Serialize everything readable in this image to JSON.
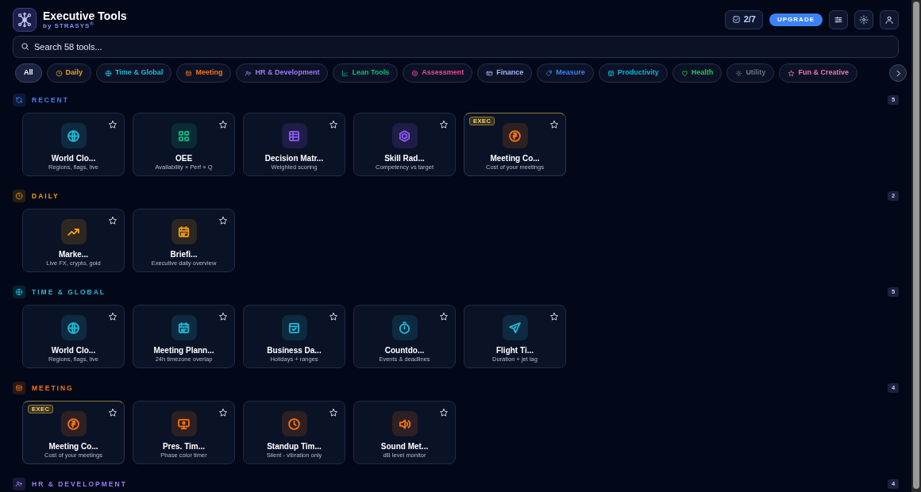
{
  "app": {
    "title": "Executive Tools",
    "subtitle": "by STRASYS",
    "subtitle_mark": "®"
  },
  "toolbar": {
    "progress": "2/7",
    "upgrade": "UPGRADE"
  },
  "search": {
    "placeholder": "Search 58 tools..."
  },
  "filters": [
    {
      "label": "All",
      "selected": true
    },
    {
      "label": "Daily",
      "selected": false,
      "color": "#f59e0b",
      "kind": "clock"
    },
    {
      "label": "Time & Global",
      "selected": false,
      "color": "#22b8d8",
      "kind": "globe"
    },
    {
      "label": "Meeting",
      "selected": false,
      "color": "#f97316",
      "kind": "board"
    },
    {
      "label": "HR & Development",
      "selected": false,
      "color": "#9b7cf6",
      "kind": "people"
    },
    {
      "label": "Lean Tools",
      "selected": false,
      "color": "#10b981",
      "kind": "chart"
    },
    {
      "label": "Assessment",
      "selected": false,
      "color": "#ec4899",
      "kind": "hexagon"
    },
    {
      "label": "Finance",
      "selected": false,
      "color": "#a5b4fc",
      "kind": "card"
    },
    {
      "label": "Measure",
      "selected": false,
      "color": "#3b82f6",
      "kind": "tag"
    },
    {
      "label": "Productivity",
      "selected": false,
      "color": "#06b6d4",
      "kind": "calendar"
    },
    {
      "label": "Health",
      "selected": false,
      "color": "#22c55e",
      "kind": "heart"
    },
    {
      "label": "Utility",
      "selected": false,
      "color": "#6b7280",
      "kind": "sun"
    },
    {
      "label": "Fun & Creative",
      "selected": false,
      "color": "#f472b6",
      "kind": "star"
    }
  ],
  "sections": [
    {
      "title": "RECENT",
      "color": "#3b82f6",
      "kind": "refresh",
      "count": "5",
      "tools": [
        {
          "name": "World Clo...",
          "desc": "Regions, flags, live",
          "kind": "globe",
          "color": "#22b8d8",
          "exec": false
        },
        {
          "name": "OEE",
          "desc": "Availability × Perf × Q",
          "kind": "grid",
          "color": "#10b981",
          "exec": false
        },
        {
          "name": "Decision Matr...",
          "desc": "Weighted scoring",
          "kind": "table",
          "color": "#8b5cf6",
          "exec": false
        },
        {
          "name": "Skill Rad...",
          "desc": "Competency vs target",
          "kind": "hexagon",
          "color": "#8b5cf6",
          "exec": false
        },
        {
          "name": "Meeting Co...",
          "desc": "Cost of your meetings",
          "kind": "coin",
          "color": "#f97316",
          "exec": true,
          "badge": "EXEC"
        }
      ]
    },
    {
      "title": "DAILY",
      "color": "#f59e0b",
      "kind": "clock",
      "count": "2",
      "tools": [
        {
          "name": "Marke...",
          "desc": "Live FX, crypto, gold",
          "kind": "trend",
          "color": "#f59e0b",
          "exec": false
        },
        {
          "name": "Briefi...",
          "desc": "Executive daily overview",
          "kind": "calendar",
          "color": "#f59e0b",
          "exec": false
        }
      ]
    },
    {
      "title": "TIME & GLOBAL",
      "color": "#22b8d8",
      "kind": "globe",
      "count": "5",
      "tools": [
        {
          "name": "World Clo...",
          "desc": "Regions, flags, live",
          "kind": "globe",
          "color": "#22b8d8",
          "exec": false
        },
        {
          "name": "Meeting Plann...",
          "desc": "24h timezone overlap",
          "kind": "calendar",
          "color": "#22b8d8",
          "exec": false
        },
        {
          "name": "Business Da...",
          "desc": "Holidays + ranges",
          "kind": "check",
          "color": "#22b8d8",
          "exec": false
        },
        {
          "name": "Countdo...",
          "desc": "Events & deadlines",
          "kind": "timer",
          "color": "#22b8d8",
          "exec": false
        },
        {
          "name": "Flight Ti...",
          "desc": "Duration + jet lag",
          "kind": "plane",
          "color": "#22b8d8",
          "exec": false
        }
      ]
    },
    {
      "title": "MEETING",
      "color": "#f97316",
      "kind": "board",
      "count": "4",
      "tools": [
        {
          "name": "Meeting Co...",
          "desc": "Cost of your meetings",
          "kind": "coin",
          "color": "#f97316",
          "exec": true,
          "badge": "EXEC"
        },
        {
          "name": "Pres. Tim...",
          "desc": "Phase color timer",
          "kind": "monitor",
          "color": "#f97316",
          "exec": false
        },
        {
          "name": "Standup Tim...",
          "desc": "Silent - vibration only",
          "kind": "clock",
          "color": "#f97316",
          "exec": false
        },
        {
          "name": "Sound Met...",
          "desc": "dB level monitor",
          "kind": "speaker",
          "color": "#f97316",
          "exec": false
        }
      ]
    },
    {
      "title": "HR & DEVELOPMENT",
      "color": "#9b7cf6",
      "kind": "people",
      "count": "4"
    }
  ]
}
